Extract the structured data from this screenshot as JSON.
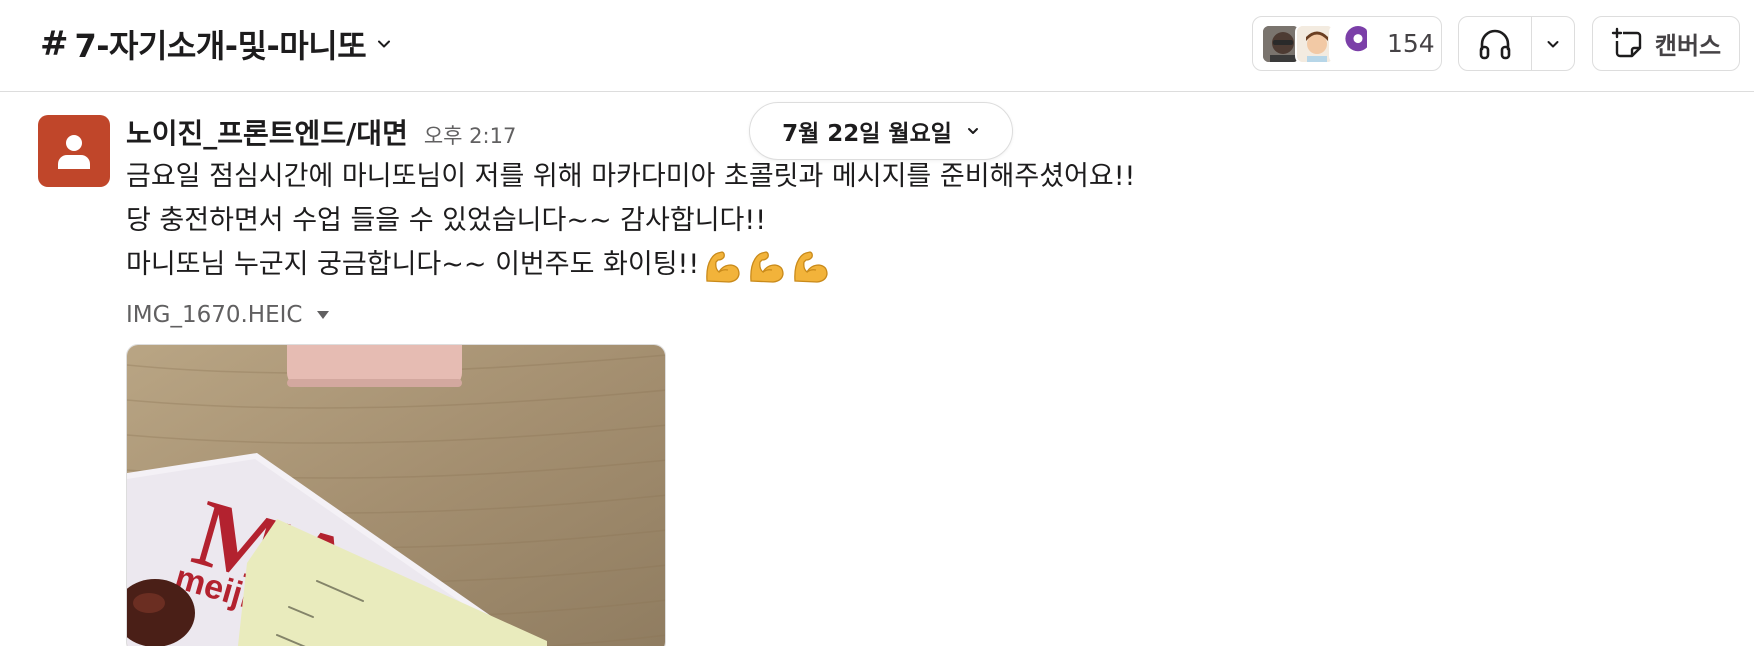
{
  "header": {
    "channel_hash": "#",
    "channel_name": "7-자기소개-및-마니또",
    "member_count": "154",
    "canvas_label": "캔버스"
  },
  "date_divider": {
    "label": "7월 22일 월요일"
  },
  "message": {
    "sender": "노이진_프론트엔드/대면",
    "time": "오후 2:17",
    "lines": [
      "금요일 점심시간에 마니또님이 저를 위해 마카다미아 초콜릿과 메시지를 준비해주셨어요!!",
      "당 충전하면서 수업 들을 수 있었습니다~~ 감사합니다!!",
      "마니또님 누군지 궁금합니다~~ 이번주도 화이팅!!"
    ],
    "emoji": [
      "flexed-biceps",
      "flexed-biceps",
      "flexed-biceps"
    ],
    "file_name": "IMG_1670.HEIC",
    "image_brand": "meiji",
    "image_letters": "MA"
  },
  "colors": {
    "avatar_bg": "#c0462a",
    "border": "#dddddd",
    "text": "#1d1c1d",
    "muted": "#616061"
  }
}
